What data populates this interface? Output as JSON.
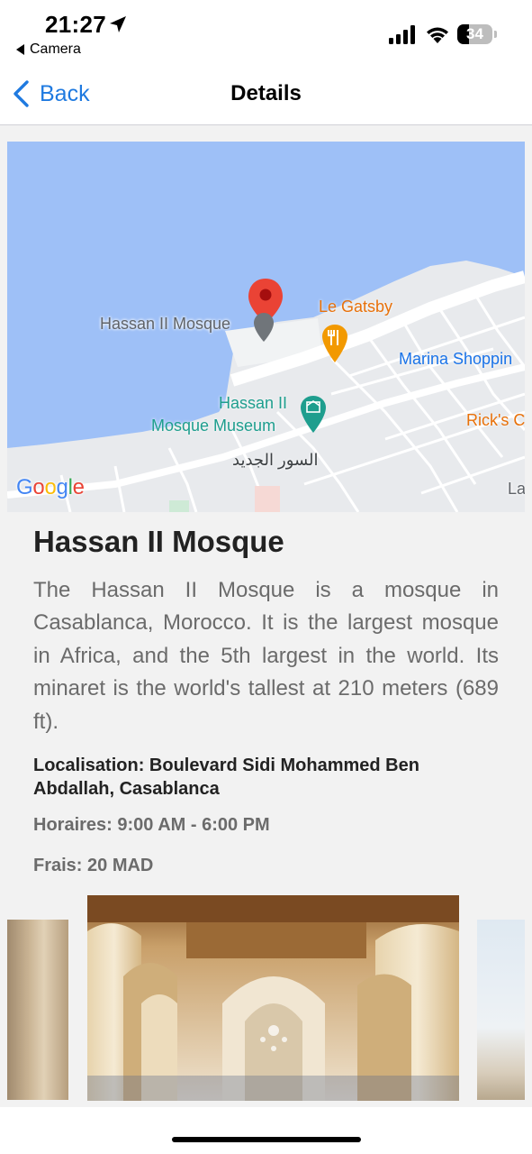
{
  "status_bar": {
    "time": "21:27",
    "back_app_label": "Camera",
    "battery_level": "34"
  },
  "nav": {
    "back_label": "Back",
    "title": "Details"
  },
  "map": {
    "place_pin_label": "Hassan II Mosque",
    "restaurant_label": "Le Gatsby",
    "shopping_label": "Marina Shoppin",
    "museum_label_line1": "Hassan II",
    "museum_label_line2": "Mosque Museum",
    "ricks_label": "Rick's C",
    "arabic_label": "السور الجديد",
    "edge_label": "La",
    "provider": "Google",
    "colors": {
      "water": "#9ec0f7",
      "land": "#e8eaed",
      "pin": "#ea4335",
      "restaurant_pin": "#f29900",
      "museum_pin": "#1e9e8e"
    }
  },
  "place": {
    "title": "Hassan II Mosque",
    "description": "The Hassan II Mosque is a mosque in Casablanca, Morocco. It is the largest mosque in Africa, and the 5th largest in the world. Its minaret is the world's tallest at 210 meters (689 ft).",
    "location": "Localisation: Boulevard Sidi Mohammed Ben Abdallah, Casablanca",
    "hours": "Horaires: 9:00 AM - 6:00 PM",
    "fees": "Frais: 20 MAD"
  },
  "icons": {
    "location_arrow": "location-arrow-icon",
    "back_chevron": "chevron-left-icon",
    "signal": "cellular-signal-icon",
    "wifi": "wifi-icon",
    "battery": "battery-icon",
    "restaurant": "fork-knife-icon",
    "museum": "museum-icon"
  }
}
